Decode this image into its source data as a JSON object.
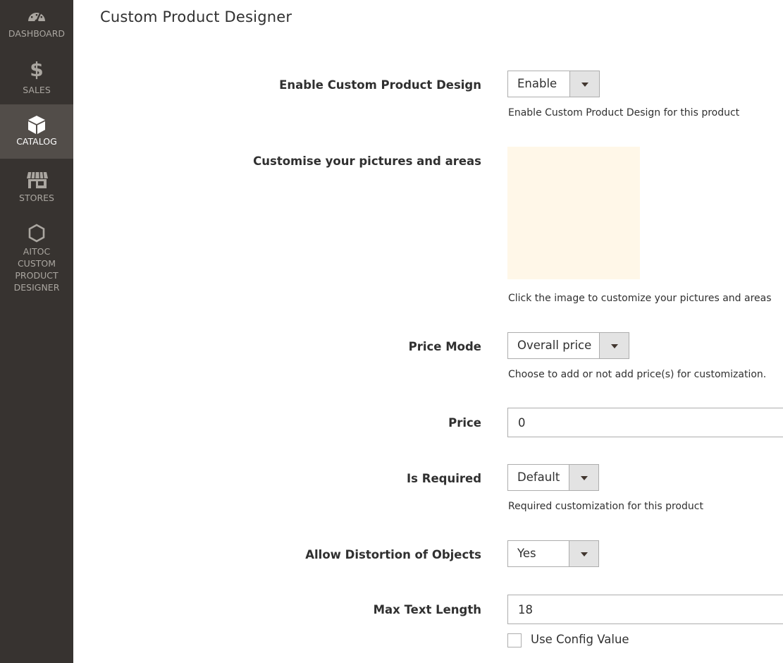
{
  "sidebar": {
    "items": [
      {
        "label": "DASHBOARD",
        "icon": "dashboard-gauge-icon",
        "active": false
      },
      {
        "label": "SALES",
        "icon": "dollar-icon",
        "active": false
      },
      {
        "label": "CATALOG",
        "icon": "box-icon",
        "active": true
      },
      {
        "label": "STORES",
        "icon": "storefront-icon",
        "active": false
      },
      {
        "label": "AITOC CUSTOM PRODUCT DESIGNER",
        "icon": "hexagon-icon",
        "active": false
      }
    ]
  },
  "page": {
    "title": "Custom Product Designer"
  },
  "form": {
    "enable_design": {
      "label": "Enable Custom Product Design",
      "value": "Enable",
      "note": "Enable Custom Product Design for this product"
    },
    "pictures": {
      "label": "Customise your pictures and areas",
      "note": "Click the image to customize your pictures and areas",
      "image_color": "#fff7e8"
    },
    "price_mode": {
      "label": "Price Mode",
      "value": "Overall price",
      "note": "Choose to add or not add price(s) for customization."
    },
    "price": {
      "label": "Price",
      "value": "0"
    },
    "is_required": {
      "label": "Is Required",
      "value": "Default",
      "note": "Required customization for this product"
    },
    "allow_distortion": {
      "label": "Allow Distortion of Objects",
      "value": "Yes"
    },
    "max_text_length": {
      "label": "Max Text Length",
      "value": "18",
      "use_config_label": "Use Config Value",
      "use_config_checked": false
    }
  },
  "colors": {
    "sidebar_bg": "#373330",
    "sidebar_active_bg": "#524d49",
    "sidebar_text": "#aaa6a0"
  }
}
